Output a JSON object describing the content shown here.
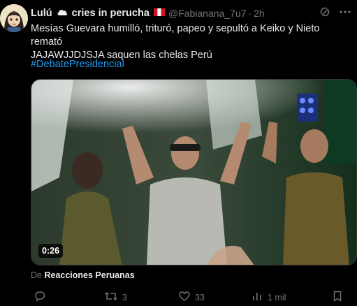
{
  "author": {
    "name_part1": "Lulú",
    "name_part2": "cries in perucha",
    "handle": "@Fabianana_7u7",
    "time": "2h"
  },
  "tweet": {
    "text": "Mesías Guevara humilló, trituró, papeo y sepultó a Keiko y Nieto remató\nJAJAWJJDJSJA saquen las chelas Perú",
    "hashtag": "#DebatePresidencial"
  },
  "media": {
    "duration": "0:26"
  },
  "attribution": {
    "prefix": "De",
    "source": "Reacciones Peruanas"
  },
  "actions": {
    "replies": "",
    "reposts": "3",
    "likes": "33",
    "views": "1 mil"
  },
  "icons": {
    "avatar": "avatar-image",
    "cloud": "cloud-emoji",
    "flag": "peru-flag-emoji",
    "grok": "grok-icon",
    "more": "more-icon",
    "reply": "reply-icon",
    "repost": "repost-icon",
    "like": "heart-icon",
    "views": "views-icon",
    "bookmark": "bookmark-icon"
  },
  "colors": {
    "background": "#000000",
    "text": "#e7e9ea",
    "muted": "#71767b",
    "link": "#1d9bf0"
  }
}
